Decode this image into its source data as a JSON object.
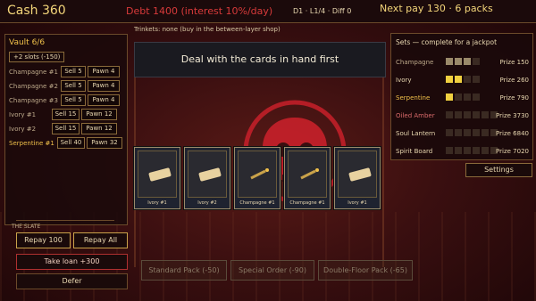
{
  "hud": {
    "cash": "Cash 360",
    "debt": "Debt 1400 (interest 10%/day)",
    "day_layer_diff": "D1 · L1/4 · Diff 0",
    "next_pay": "Next pay 130 · 6 packs",
    "trinkets": "Trinkets: none (buy in the between-layer shop)"
  },
  "vault": {
    "title": "Vault 6/6",
    "slots_button": "+2 slots (-150)",
    "items": [
      {
        "name": "Champagne #1",
        "sell": "Sell 5",
        "pawn": "Pawn 4",
        "highlight": false
      },
      {
        "name": "Champagne #2",
        "sell": "Sell 5",
        "pawn": "Pawn 4",
        "highlight": false
      },
      {
        "name": "Champagne #3",
        "sell": "Sell 5",
        "pawn": "Pawn 4",
        "highlight": false
      },
      {
        "name": "Ivory #1",
        "sell": "Sell 15",
        "pawn": "Pawn 12",
        "highlight": false
      },
      {
        "name": "Ivory #2",
        "sell": "Sell 15",
        "pawn": "Pawn 12",
        "highlight": false
      },
      {
        "name": "Serpentine #1",
        "sell": "Sell 40",
        "pawn": "Pawn 32",
        "highlight": true
      }
    ]
  },
  "slate": {
    "label": "THE SLATE",
    "repay_100": "Repay 100",
    "repay_all": "Repay All",
    "take_loan": "Take loan +300",
    "defer": "Defer"
  },
  "message": "Deal with the cards in hand first",
  "hand": [
    {
      "label": "Ivory",
      "num": "#1"
    },
    {
      "label": "Ivory",
      "num": "#2"
    },
    {
      "label": "Champagne",
      "num": "#1"
    },
    {
      "label": "Champagne",
      "num": "#1"
    },
    {
      "label": "Ivory",
      "num": "#1"
    }
  ],
  "sets": {
    "title": "Sets — complete for a jackpot",
    "rows": [
      {
        "name": "Champagne",
        "prize": "Prize 150",
        "color": "#bda98a",
        "filled": 3,
        "total": 4,
        "fill": "#9a8a6a"
      },
      {
        "name": "Ivory",
        "prize": "Prize 260",
        "color": "#e8d7b0",
        "filled": 2,
        "total": 4,
        "fill": "#f0d040"
      },
      {
        "name": "Serpentine",
        "prize": "Prize 790",
        "color": "#f0c04a",
        "filled": 1,
        "total": 4,
        "fill": "#f0d040"
      },
      {
        "name": "Oiled Amber",
        "prize": "Prize 3730",
        "color": "#d86a6a",
        "filled": 0,
        "total": 6,
        "fill": "#3a2a22"
      },
      {
        "name": "Soul Lantern",
        "prize": "Prize 6840",
        "color": "#e8d7b0",
        "filled": 0,
        "total": 6,
        "fill": "#3a2a22"
      },
      {
        "name": "Spirit Board",
        "prize": "Prize 7020",
        "color": "#e8d7b0",
        "filled": 0,
        "total": 6,
        "fill": "#3a2a22"
      }
    ],
    "settings": "Settings"
  },
  "shop": {
    "standard": "Standard Pack (-50)",
    "special": "Special Order (-90)",
    "double": "Double-Floor Pack (-65)"
  }
}
